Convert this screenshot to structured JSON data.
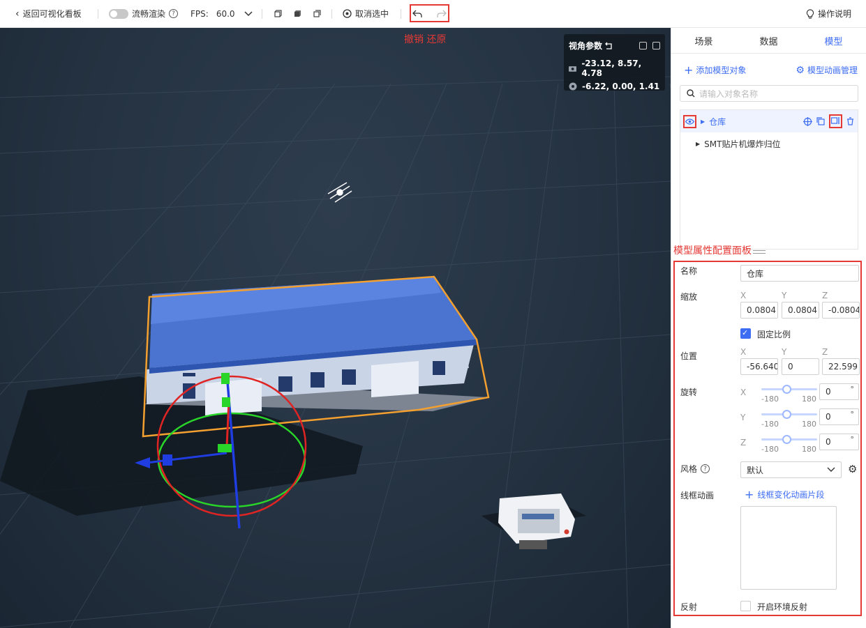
{
  "toolbar": {
    "back_label": "返回可视化看板",
    "smooth_label": "流畅渲染",
    "fps_label": "FPS:",
    "fps_value": "60.0",
    "deselect_label": "取消选中",
    "help_label": "操作说明"
  },
  "annotations": {
    "undo_redo": "撤销 还原",
    "panel": "模型属性配置面板"
  },
  "camera": {
    "title": "视角参数",
    "position": "-23.12, 8.57, 4.78",
    "target": "-6.22, 0.00, 1.41"
  },
  "tabs": [
    "场景",
    "数据",
    "模型"
  ],
  "active_tab": "模型",
  "actions": {
    "add_model": "添加模型对象",
    "anim_manage": "模型动画管理"
  },
  "search": {
    "placeholder": "请输入对象名称"
  },
  "tree": [
    {
      "label": "仓库"
    },
    {
      "label": "SMT贴片机爆炸归位"
    }
  ],
  "props": {
    "name_label": "名称",
    "name_value": "仓库",
    "scale_label": "缩放",
    "scale": {
      "x": "0.0804",
      "y": "0.0804",
      "z": "-0.0804"
    },
    "lock_ratio_label": "固定比例",
    "position_label": "位置",
    "position": {
      "x": "-56.640",
      "y": "0",
      "z": "22.599"
    },
    "rotation_label": "旋转",
    "rotation": {
      "x": "0",
      "y": "0",
      "z": "0"
    },
    "rotation_min": "-180",
    "rotation_max": "180",
    "degree_symbol": "°",
    "axes": {
      "x": "X",
      "y": "Y",
      "z": "Z"
    },
    "style_label": "风格",
    "style_value": "默认",
    "wire_anim_label": "线框动画",
    "wire_anim_add": "线框变化动画片段",
    "reflect_label": "反射",
    "reflect_option": "开启环境反射"
  }
}
